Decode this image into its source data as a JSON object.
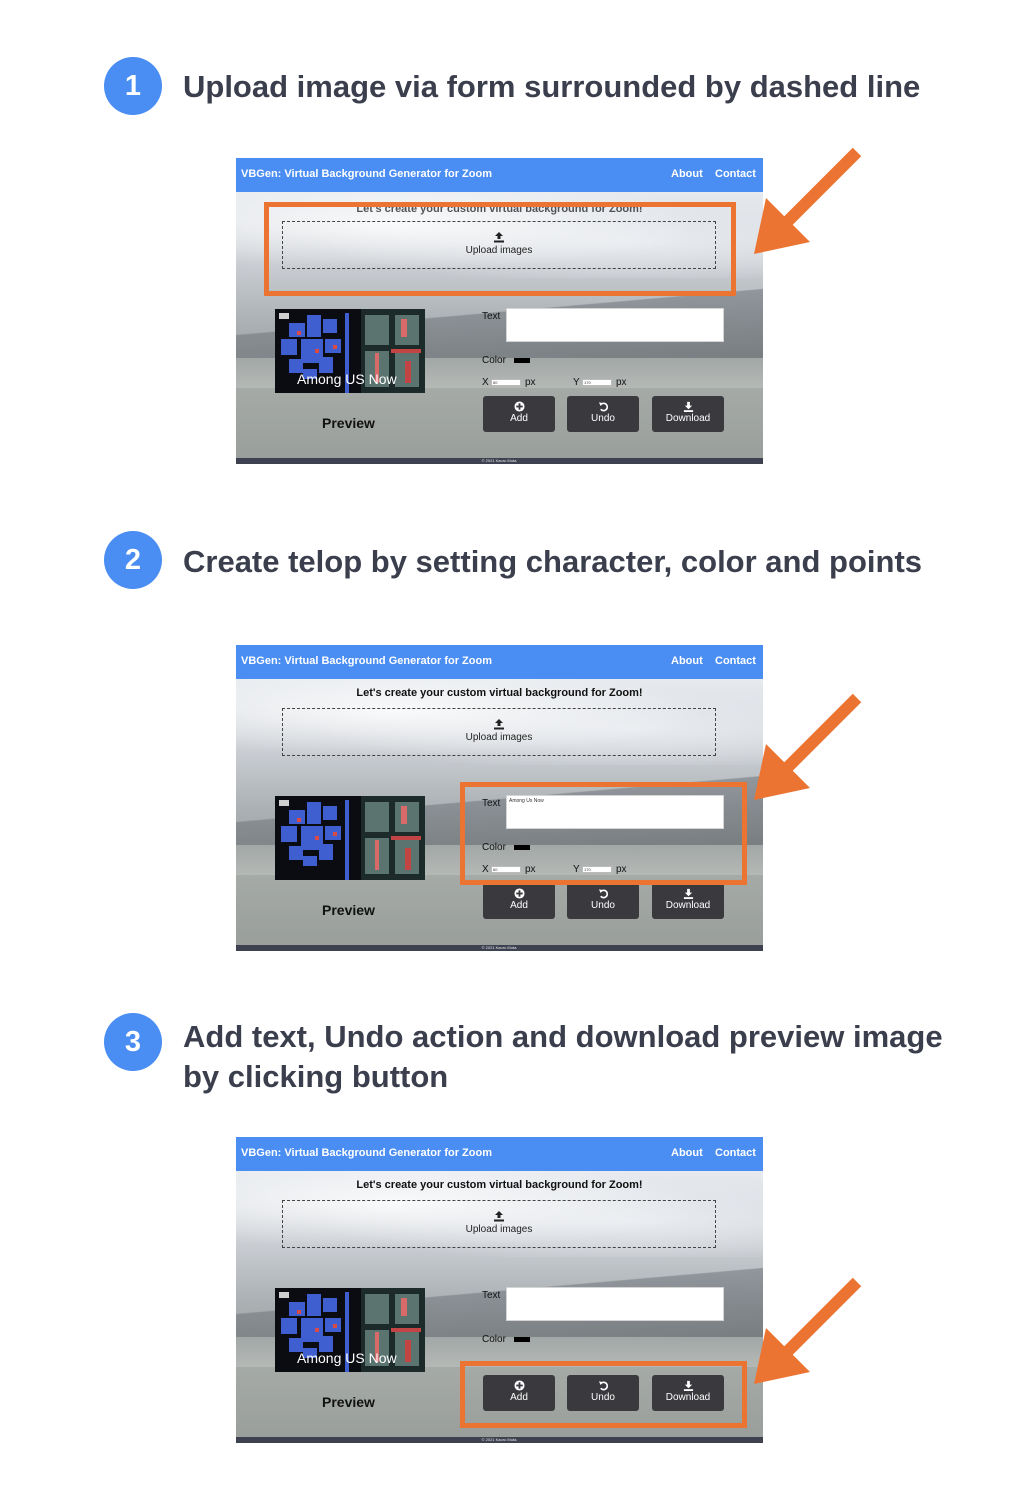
{
  "steps": [
    {
      "number": "1",
      "title": "Upload image via form surrounded by dashed line"
    },
    {
      "number": "2",
      "title": "Create telop by setting character, color and points"
    },
    {
      "number": "3",
      "title": "Add text, Undo action and download preview image by clicking button"
    }
  ],
  "app": {
    "title": "VBGen: Virtual Background Generator for Zoom",
    "nav_about": "About",
    "nav_contact": "Contact",
    "tagline": "Let's create your custom virtual background for Zoom!",
    "upload_label": "Upload images",
    "preview_overlay": "Among US Now",
    "preview_label": "Preview",
    "text_label": "Text",
    "text_value_step2": "Among Us Now",
    "color_label": "Color",
    "x_label": "X",
    "x_value": "60",
    "y_label": "Y",
    "y_value": "170",
    "px_unit": "px",
    "add_label": "Add",
    "undo_label": "Undo",
    "download_label": "Download",
    "footer": "© 2021 Kaoru Muta."
  },
  "colors": {
    "accent": "#4a8df3",
    "highlight": "#ec7432",
    "button": "#3a3a3e",
    "footer": "#3d4150"
  }
}
